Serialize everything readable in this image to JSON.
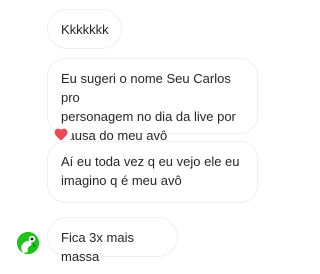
{
  "chat": {
    "messages": [
      {
        "text": "Kkkkkkk"
      },
      {
        "text": "Eu sugeri o nome Seu Carlos pro\npersonagem no dia da live por\ncausa do meu avô",
        "reaction": "heart-icon"
      },
      {
        "text": "Aí eu toda vez q eu vejo ele eu\nimagino q é meu avô"
      },
      {
        "text": "Fica 3x mais massa"
      }
    ],
    "colors": {
      "bubble_border": "#efefef",
      "text": "#262626",
      "reaction_heart": "#ed4956",
      "avatar_bg": "#1ec21a"
    }
  }
}
